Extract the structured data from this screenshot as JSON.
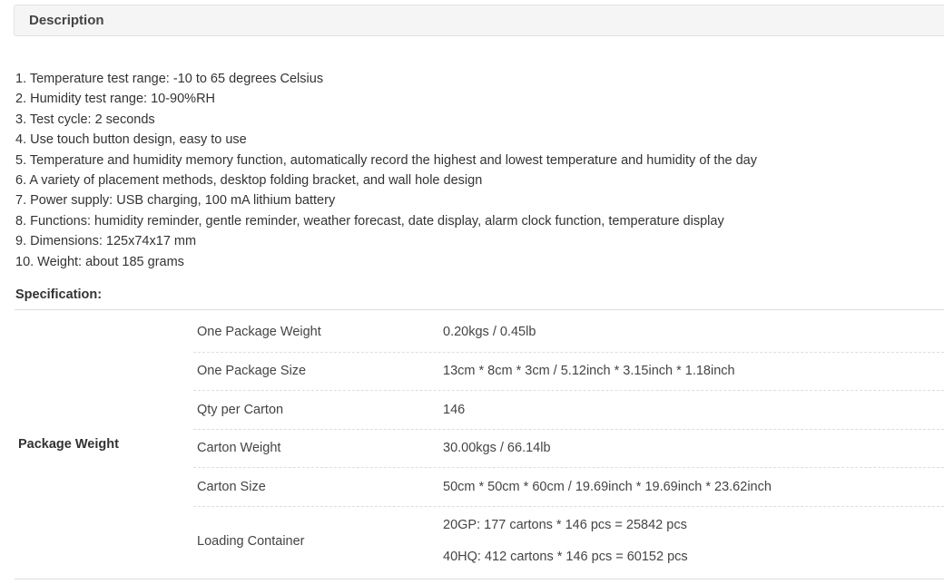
{
  "description": {
    "title": "Description",
    "items": [
      "1. Temperature test range: -10 to 65 degrees Celsius",
      "2. Humidity test range: 10-90%RH",
      "3. Test cycle: 2 seconds",
      "4. Use touch button design, easy to use",
      "5. Temperature and humidity memory function, automatically record the highest and lowest temperature and humidity of the day",
      "6. A variety of placement methods, desktop folding bracket, and wall hole design",
      "7. Power supply: USB charging, 100 mA lithium battery",
      "8. Functions: humidity reminder, gentle reminder, weather forecast, date display, alarm clock function, temperature display",
      "9. Dimensions: 125x74x17 mm",
      "10. Weight: about 185 grams"
    ]
  },
  "specification": {
    "title": "Specification:",
    "group_label": "Package Weight",
    "rows": [
      {
        "key": "One Package Weight",
        "value": "0.20kgs / 0.45lb"
      },
      {
        "key": "One Package Size",
        "value": "13cm * 8cm * 3cm / 5.12inch * 3.15inch * 1.18inch"
      },
      {
        "key": "Qty per Carton",
        "value": "146"
      },
      {
        "key": "Carton Weight",
        "value": "30.00kgs / 66.14lb"
      },
      {
        "key": "Carton Size",
        "value": "50cm * 50cm * 60cm / 19.69inch * 19.69inch * 23.62inch"
      },
      {
        "key": "Loading Container",
        "value": "20GP: 177 cartons * 146 pcs = 25842 pcs",
        "value2": "40HQ: 412 cartons * 146 pcs = 60152 pcs"
      }
    ]
  }
}
